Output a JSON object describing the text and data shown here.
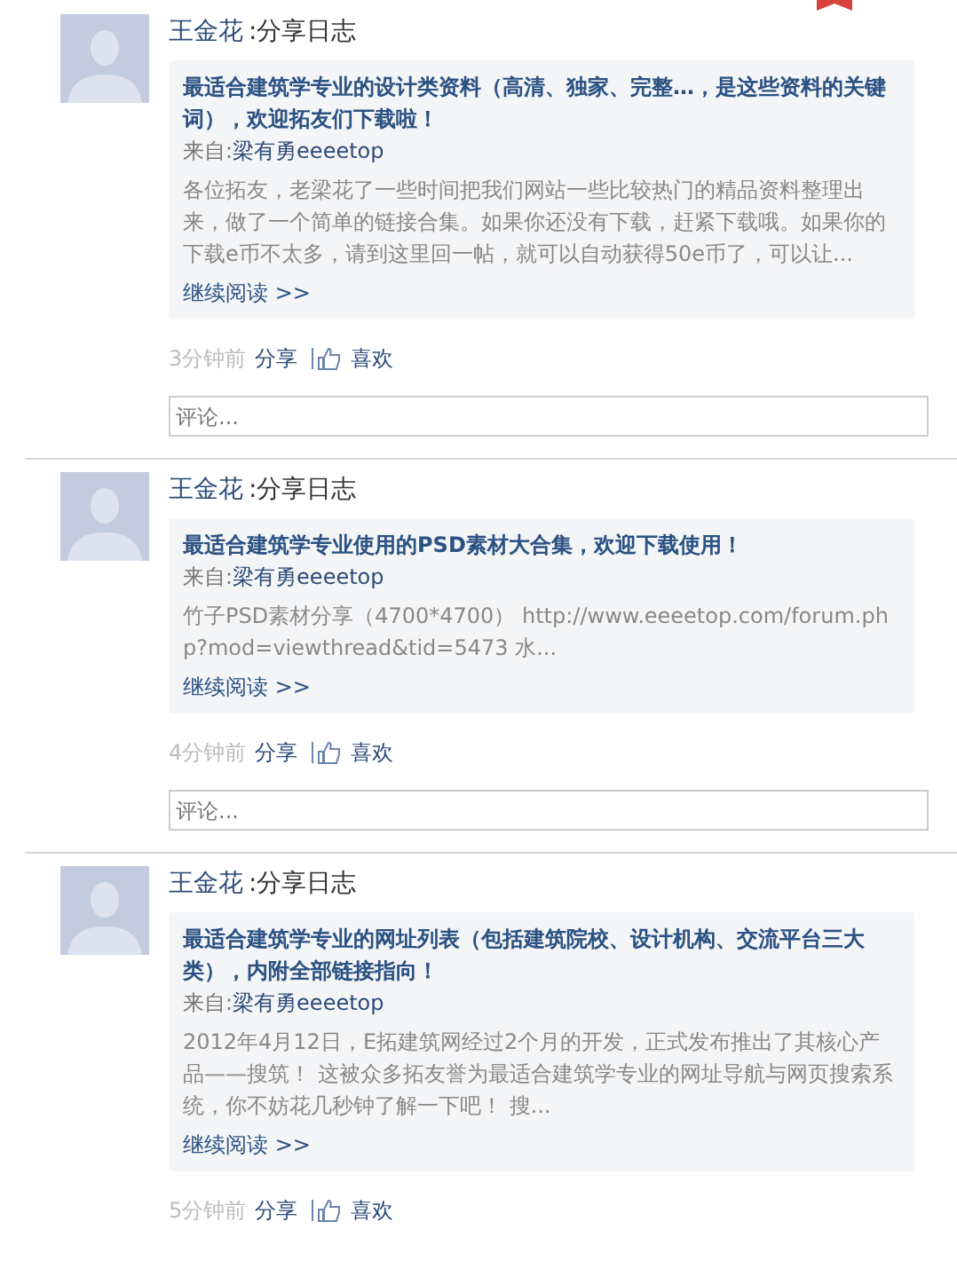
{
  "posts": [
    {
      "author": "王金花",
      "action": ":分享日志",
      "title": "最适合建筑学专业的设计类资料（高清、独家、完整…，是这些资料的关键词），欢迎拓友们下载啦！",
      "source_label": "来自:",
      "source": "梁有勇eeeetop",
      "excerpt": "各位拓友，老梁花了一些时间把我们网站一些比较热门的精品资料整理出来，做了一个简单的链接合集。如果你还没有下载，赶紧下载哦。如果你的下载e币不太多，请到这里回一帖，就可以自动获得50e币了，可以让...",
      "read_more": "继续阅读 >>",
      "time": "3分钟前",
      "share": "分享",
      "like": "喜欢",
      "comment": {
        "placeholder": "评论..."
      }
    },
    {
      "author": "王金花",
      "action": ":分享日志",
      "title": "最适合建筑学专业使用的PSD素材大合集，欢迎下载使用！",
      "source_label": "来自:",
      "source": "梁有勇eeeetop",
      "excerpt": "竹子PSD素材分享（4700*4700） http://www.eeeetop.com/forum.php?mod=viewthread&tid=5473 水...",
      "read_more": "继续阅读 >>",
      "time": "4分钟前",
      "share": "分享",
      "like": "喜欢",
      "comment": {
        "placeholder": "评论..."
      }
    },
    {
      "author": "王金花",
      "action": ":分享日志",
      "title": "最适合建筑学专业的网址列表（包括建筑院校、设计机构、交流平台三大类），内附全部链接指向！",
      "source_label": "来自:",
      "source": "梁有勇eeeetop",
      "excerpt": "2012年4月12日，E拓建筑网经过2个月的开发，正式发布推出了其核心产品——搜筑！ 这被众多拓友誉为最适合建筑学专业的网址导航与网页搜索系统，你不妨花几秒钟了解一下吧！ 搜...",
      "read_more": "继续阅读 >>",
      "time": "5分钟前",
      "share": "分享",
      "like": "喜欢"
    }
  ]
}
